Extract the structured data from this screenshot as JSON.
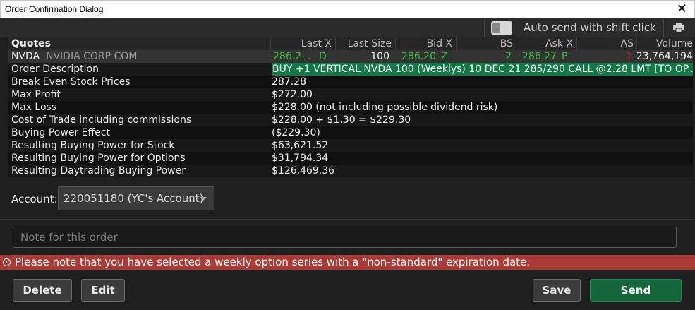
{
  "window": {
    "title": "Order Confirmation Dialog"
  },
  "toolbar": {
    "auto_send_label": "Auto send with shift click"
  },
  "quotes": {
    "headers": {
      "quotes": "Quotes",
      "last_x": "Last X",
      "last_size": "Last Size",
      "bid_x": "Bid X",
      "bs": "BS",
      "ask_x": "Ask X",
      "as": "AS",
      "volume": "Volume"
    },
    "row": {
      "symbol": "NVDA",
      "name": "NVIDIA CORP COM",
      "last": "286.2...",
      "last_exch": "D",
      "last_size": "100",
      "bid": "286.20",
      "bid_exch": "Z",
      "bs": "2",
      "ask": "286.27",
      "ask_exch": "P",
      "as": "1",
      "volume": "23,764,194"
    }
  },
  "details": [
    {
      "label": "Order Description",
      "value": "BUY +1 VERTICAL NVDA 100 (Weeklys) 10 DEC 21 285/290 CALL @2.28 LMT [TO OP..."
    },
    {
      "label": "Break Even Stock Prices",
      "value": "287.28"
    },
    {
      "label": "Max Profit",
      "value": "$272.00"
    },
    {
      "label": "Max Loss",
      "value": "$228.00 (not including possible dividend risk)"
    },
    {
      "label": "Cost of Trade including commissions",
      "value": "$228.00 + $1.30 = $229.30"
    },
    {
      "label": "Buying Power Effect",
      "value": "($229.30)"
    },
    {
      "label": "Resulting Buying Power for Stock",
      "value": "$63,621.52"
    },
    {
      "label": "Resulting Buying Power for Options",
      "value": "$31,794.34"
    },
    {
      "label": "Resulting Daytrading Buying Power",
      "value": "$126,469.36"
    }
  ],
  "account": {
    "label": "Account:",
    "value": "220051180 (YC's Account)"
  },
  "note": {
    "placeholder": "Note for this order",
    "value": ""
  },
  "warning": {
    "text": "Please note that you have selected a weekly option series with a \"non-standard\" expiration date."
  },
  "buttons": {
    "delete": "Delete",
    "edit": "Edit",
    "save": "Save",
    "send": "Send"
  },
  "icons": {
    "close": "close-icon",
    "print": "printer-icon",
    "warning": "alert-circle-icon"
  },
  "colors": {
    "green": "#3fbf3f",
    "red": "#e0302a",
    "description_bg": "#0f7a45",
    "warning_bg": "#a93a36",
    "send_bg": "#12663a"
  }
}
